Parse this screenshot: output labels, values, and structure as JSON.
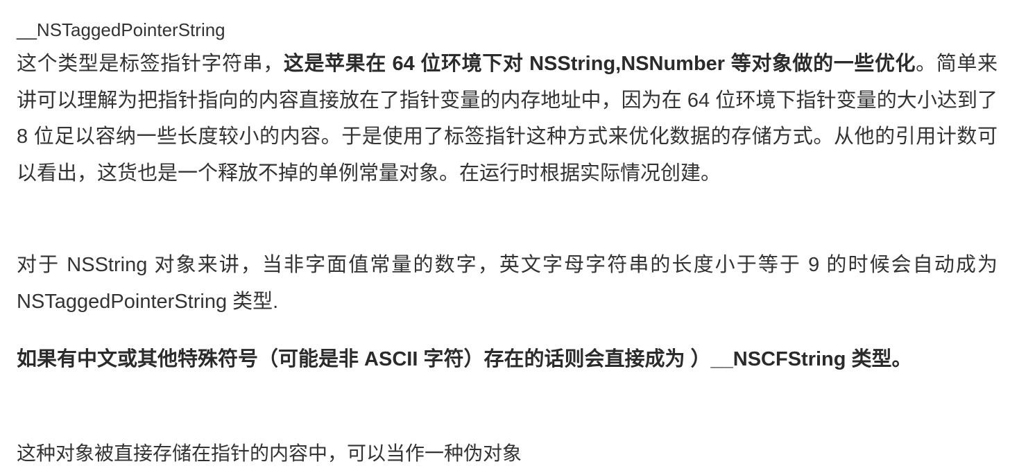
{
  "document": {
    "type_name_line": "__NSTaggedPointerString",
    "paragraph1": {
      "part1": "这个类型是标签指针字符串，",
      "part2_bold": "这是苹果在 64 位环境下对 NSString,NSNumber 等对象做的一些优化",
      "part3": "。简单来讲可以理解为把指针指向的内容直接放在了指针变量的内存地址中，因为在 64 位环境下指针变量的大小达到了 8 位足以容纳一些长度较小的内容。于是使用了标签指针这种方式来优化数据的存储方式。从他的引用计数可以看出，这货也是一个释放不掉的单例常量对象。在运行时根据实际情况创建。"
    },
    "paragraph2": "对于 NSString 对象来讲，当非字面值常量的数字，英文字母字符串的长度小于等于 9 的时候会自动成为 NSTaggedPointerString 类型.",
    "paragraph3_bold": "如果有中文或其他特殊符号（可能是非 ASCII 字符）存在的话则会直接成为 ）__NSCFString 类型。",
    "last_line": "这种对象被直接存储在指针的内容中，可以当作一种伪对象"
  }
}
